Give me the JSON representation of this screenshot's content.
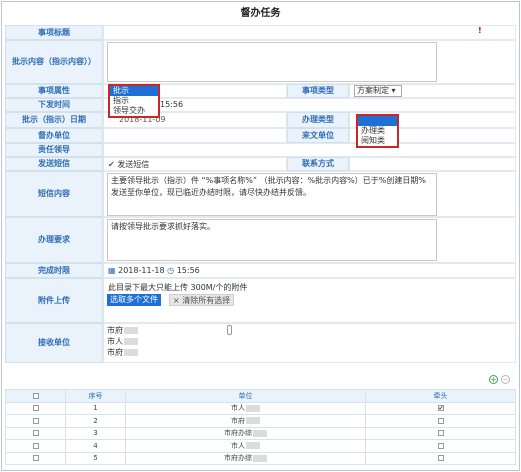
{
  "page": {
    "title": "督办任务"
  },
  "form": {
    "fields": {
      "subject_label": "事项标题",
      "instruction_content_label": "批示内容（指示内容））",
      "attribute_label": "事项属性",
      "issue_time_label": "下发时间",
      "instruction_date_label": "批示（指示）日期",
      "supervising_unit_label": "督办单位",
      "responsible_leader_label": "责任领导",
      "send_sms_label": "发送短信",
      "sms_content_label": "短信内容",
      "handling_req_label": "办理要求",
      "deadline_label": "完成时限",
      "attachment_label": "附件上传",
      "receiving_unit_label": "接收单位",
      "item_type_label": "事项类型",
      "handle_type_label": "办理类型",
      "incoming_unit_label": "来文单位",
      "contact_label": "联系方式"
    },
    "required_mark": "!",
    "attribute_options": [
      "批示",
      "指示",
      "领导交办"
    ],
    "attribute_selected": "批示",
    "issue_time_value": "15:56",
    "instruction_date_value": "2018-11-09",
    "item_type_value": "方案制定",
    "handle_type_options": [
      "",
      "办理类",
      "阅知类"
    ],
    "send_sms_option": "发送短信",
    "sms_content": "主要领导批示（指示）件 “%事项名称%” （批示内容：%批示内容%）已于%创建日期%发送至你单位，现已临近办结时限，请尽快办结并反馈。",
    "handling_req": "请按领导批示要求抓好落实。",
    "deadline_date": "2018-11-18",
    "deadline_time": "15:56",
    "attachment_hint": "此目录下最大只能上传 300M/个的附件",
    "upload_button": "选取多个文件",
    "clear_button": "清除所有选择",
    "receiving_units": [
      "市府",
      "市人",
      "市府"
    ]
  },
  "grid": {
    "headers": [
      "",
      "序号",
      "单位",
      "牵头"
    ],
    "rows": [
      {
        "no": "1",
        "unit": "市人",
        "lead": true
      },
      {
        "no": "2",
        "unit": "市府",
        "lead": false
      },
      {
        "no": "3",
        "unit": "市府办综",
        "lead": false
      },
      {
        "no": "4",
        "unit": "市人",
        "lead": false
      },
      {
        "no": "5",
        "unit": "市府办综",
        "lead": false
      }
    ]
  },
  "colors": {
    "label_text": "#2f6db6",
    "label_bg": "#eaf2fb",
    "accent": "#1e6fd6",
    "highlight_border": "#c82828",
    "add_icon": "#3aa84a"
  },
  "icons": [
    "calendar-icon",
    "clock-icon",
    "check-icon",
    "close-icon",
    "add-icon",
    "remove-icon",
    "scroll-handle-icon"
  ]
}
